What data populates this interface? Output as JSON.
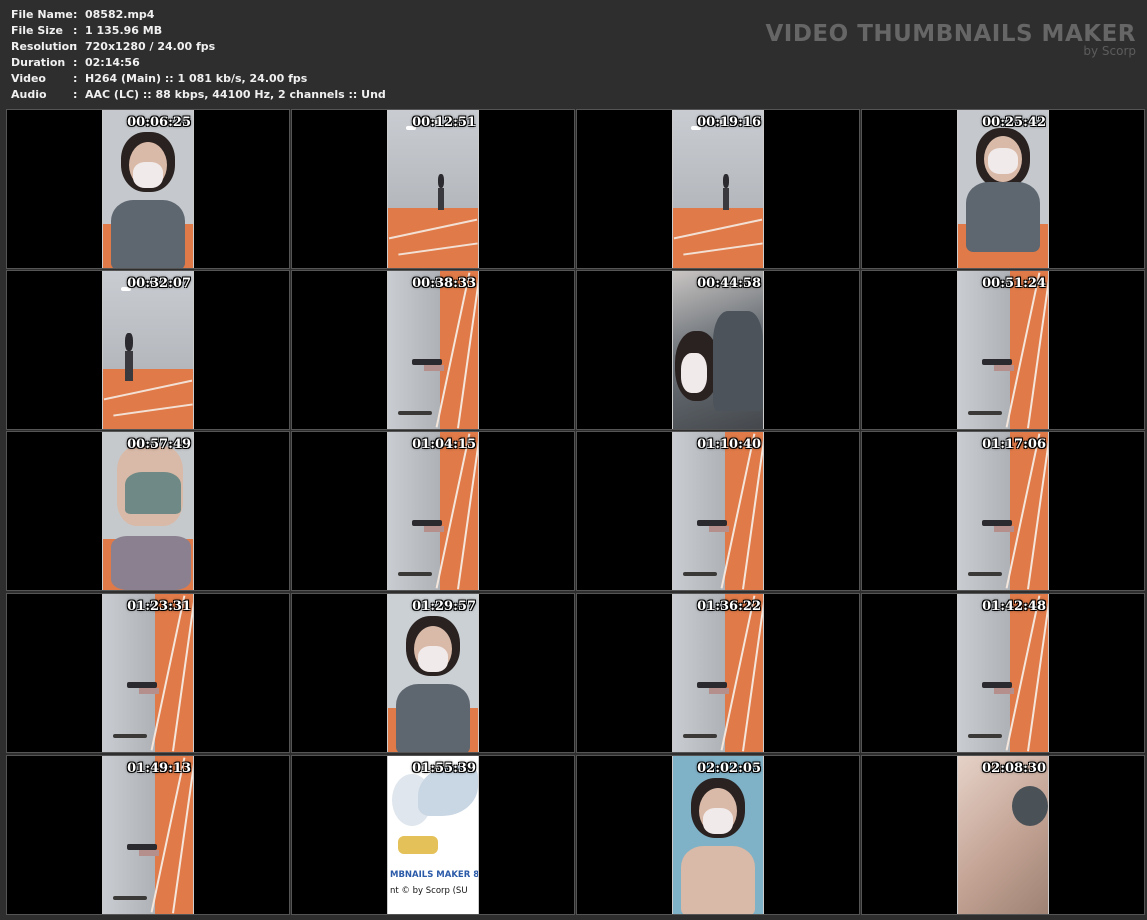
{
  "info": [
    {
      "label": "File Name",
      "value": "08582.mp4"
    },
    {
      "label": "File Size",
      "value": "1 135.96 MB"
    },
    {
      "label": "Resolution",
      "value": "720x1280 / 24.00 fps"
    },
    {
      "label": "Duration",
      "value": "02:14:56"
    },
    {
      "label": "Video",
      "value": "H264 (Main) :: 1 081 kb/s, 24.00 fps"
    },
    {
      "label": "Audio",
      "value": "AAC (LC) :: 88 kbps, 44100 Hz, 2 channels :: Und"
    }
  ],
  "brand": {
    "title": "VIDEO THUMBNAILS MAKER",
    "subtitle": "by Scorp"
  },
  "thumbnails": [
    {
      "time": "00:06:25",
      "scene": "face-close"
    },
    {
      "time": "00:12:51",
      "scene": "court-far"
    },
    {
      "time": "00:19:16",
      "scene": "court-far"
    },
    {
      "time": "00:25:42",
      "scene": "face-arms"
    },
    {
      "time": "00:32:07",
      "scene": "court-mid"
    },
    {
      "time": "00:38:33",
      "scene": "rotated"
    },
    {
      "time": "00:44:58",
      "scene": "blur-close"
    },
    {
      "time": "00:51:24",
      "scene": "rotated"
    },
    {
      "time": "00:57:49",
      "scene": "torso"
    },
    {
      "time": "01:04:15",
      "scene": "rotated"
    },
    {
      "time": "01:10:40",
      "scene": "rotated"
    },
    {
      "time": "01:17:06",
      "scene": "rotated"
    },
    {
      "time": "01:23:31",
      "scene": "rotated"
    },
    {
      "time": "01:29:57",
      "scene": "face-close2"
    },
    {
      "time": "01:36:22",
      "scene": "rotated"
    },
    {
      "time": "01:42:48",
      "scene": "rotated"
    },
    {
      "time": "01:49:13",
      "scene": "rotated"
    },
    {
      "time": "01:55:39",
      "scene": "logo",
      "logo_line1": "MBNAILS MAKER 8",
      "logo_line2": "nt © by Scorp (SU"
    },
    {
      "time": "02:02:05",
      "scene": "face-close3"
    },
    {
      "time": "02:08:30",
      "scene": "skin-close"
    }
  ]
}
